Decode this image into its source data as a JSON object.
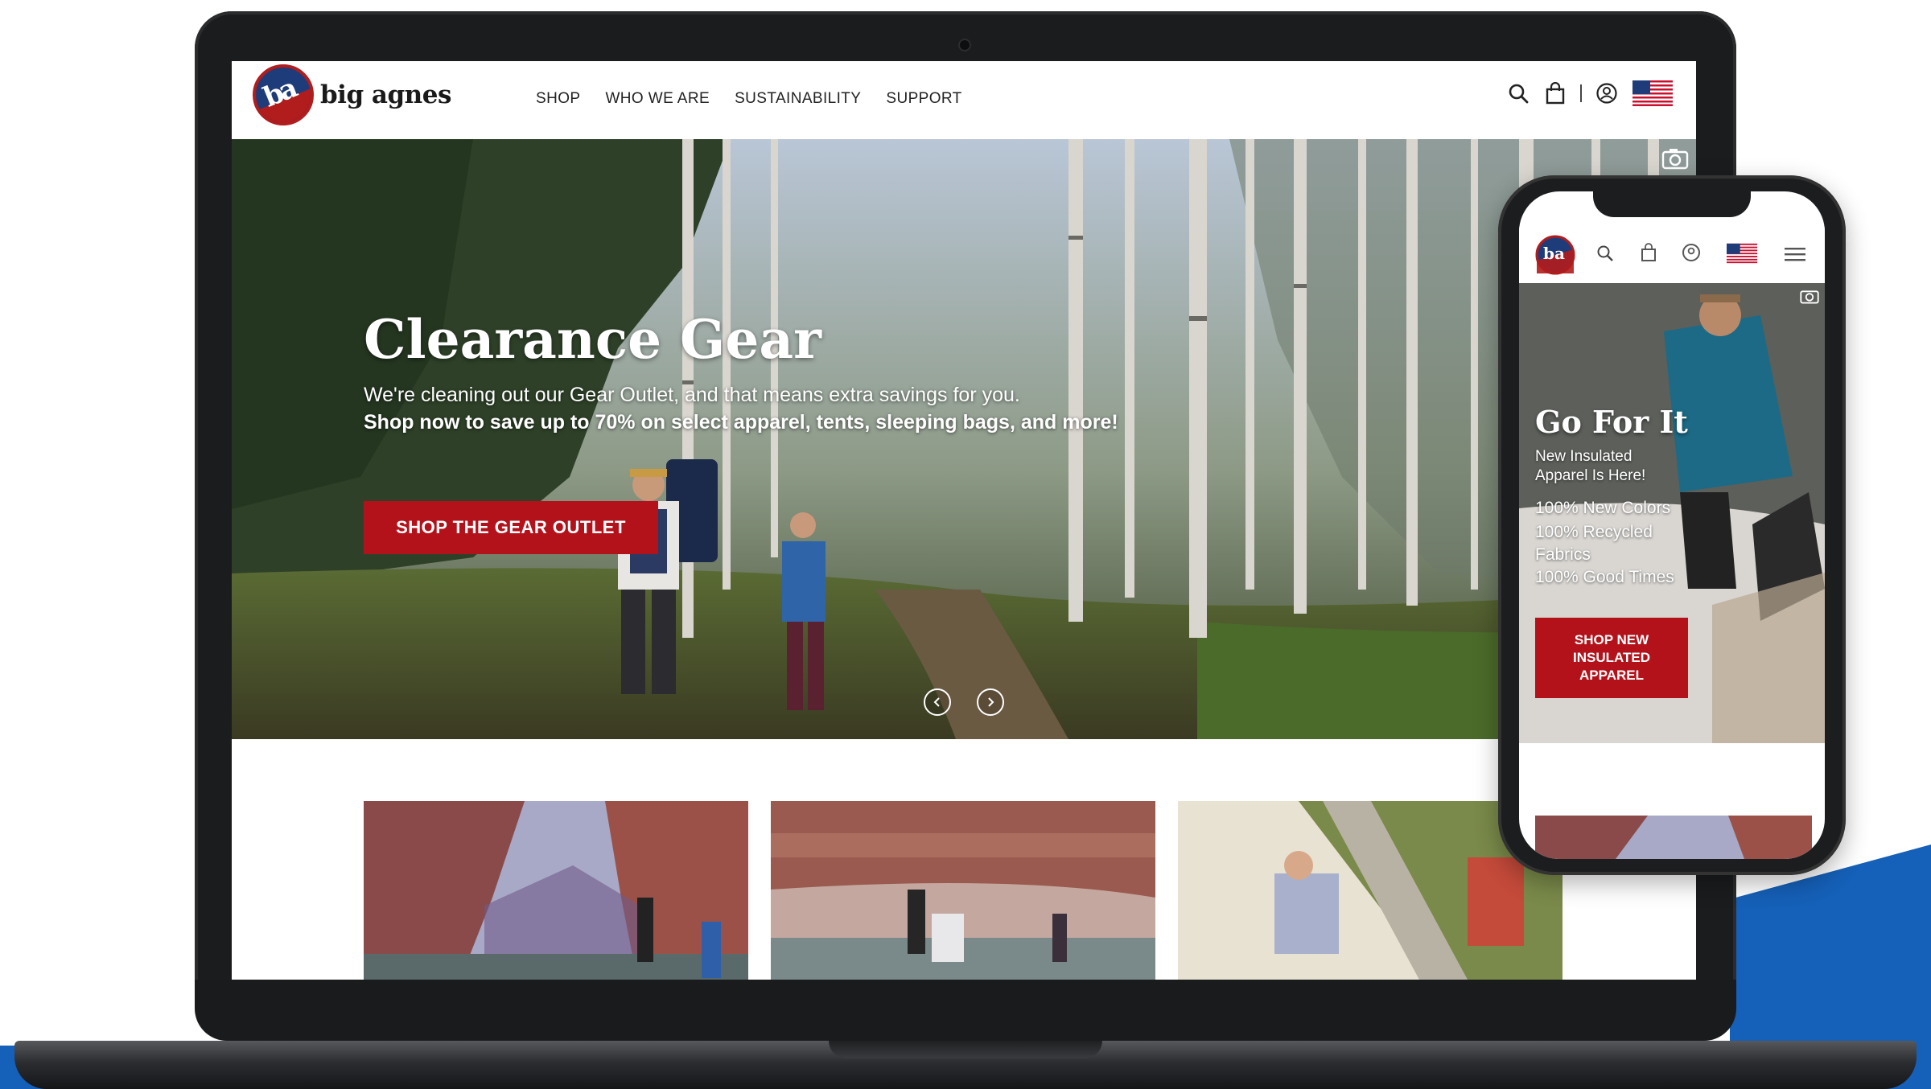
{
  "brand": {
    "name": "big agnes",
    "monogram": "ba",
    "colors": {
      "accent_red": "#b3121b",
      "navy": "#1f3c7a",
      "background_blue": "#1560b8"
    }
  },
  "desktop": {
    "nav": {
      "items": [
        {
          "label": "SHOP"
        },
        {
          "label": "WHO WE ARE"
        },
        {
          "label": "SUSTAINABILITY"
        },
        {
          "label": "SUPPORT"
        }
      ],
      "icons": [
        "search-icon",
        "shopping-bag-icon",
        "account-icon",
        "us-flag-icon"
      ]
    },
    "hero": {
      "title": "Clearance Gear",
      "line1": "We're cleaning out our Gear Outlet, and that means extra savings for you.",
      "line2": "Shop now to save up to 70% on select apparel, tents, sleeping bags, and more!",
      "cta": "SHOP THE GEAR OUTLET",
      "carousel": {
        "prev": "previous-arrow-icon",
        "next": "next-arrow-icon"
      }
    }
  },
  "mobile": {
    "hero": {
      "title": "Go For It",
      "subtitle": "New Insulated Apparel Is Here!",
      "bullets": [
        "100% New Colors",
        "100% Recycled Fabrics",
        "100% Good Times"
      ],
      "cta": "SHOP NEW INSULATED APPAREL"
    }
  }
}
